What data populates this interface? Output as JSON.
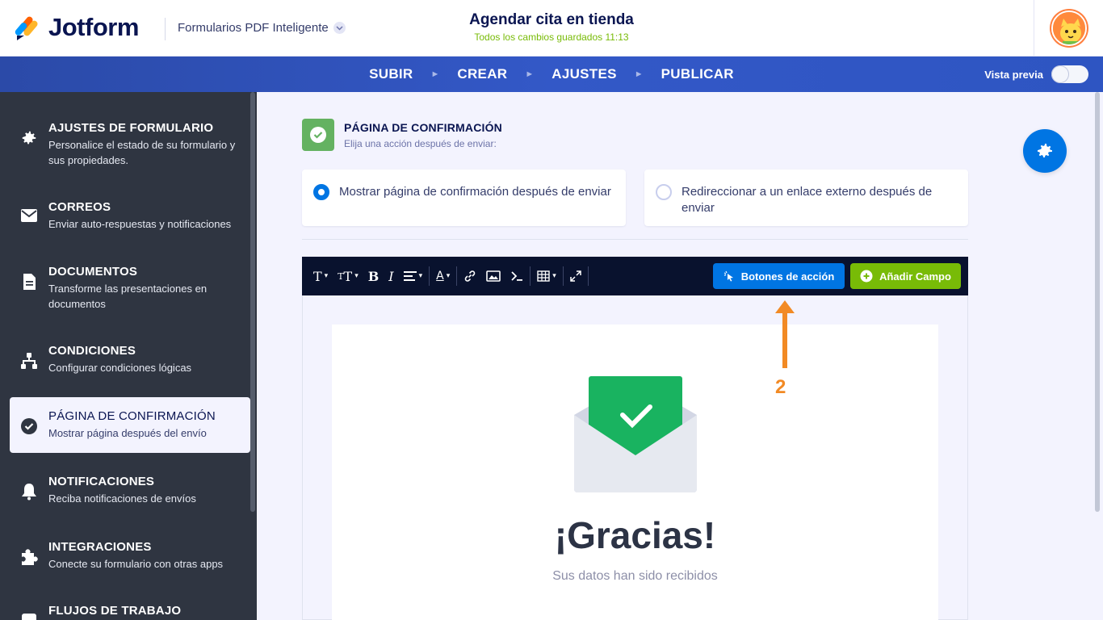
{
  "header": {
    "logo_text": "Jotform",
    "product": "Formularios PDF Inteligente",
    "form_title": "Agendar cita en tienda",
    "saved_status": "Todos los cambios guardados 11:13"
  },
  "nav": {
    "steps": [
      "SUBIR",
      "CREAR",
      "AJUSTES",
      "PUBLICAR"
    ],
    "preview_label": "Vista previa",
    "preview_enabled": false
  },
  "sidebar": {
    "items": [
      {
        "title": "AJUSTES DE FORMULARIO",
        "desc": "Personalice el estado de su formulario y sus propiedades.",
        "icon": "gear-icon"
      },
      {
        "title": "CORREOS",
        "desc": "Enviar auto-respuestas y notificaciones",
        "icon": "envelope-icon"
      },
      {
        "title": "DOCUMENTOS",
        "desc": "Transforme las presentaciones en documentos",
        "icon": "document-icon"
      },
      {
        "title": "CONDICIONES",
        "desc": "Configurar condiciones lógicas",
        "icon": "sitemap-icon"
      },
      {
        "title": "PÁGINA DE CONFIRMACIÓN",
        "desc": "Mostrar página después del envío",
        "icon": "check-circle-icon",
        "active": true
      },
      {
        "title": "NOTIFICACIONES",
        "desc": "Reciba notificaciones de envíos",
        "icon": "bell-icon"
      },
      {
        "title": "INTEGRACIONES",
        "desc": "Conecte su formulario con otras apps",
        "icon": "puzzle-icon"
      },
      {
        "title": "FLUJOS DE TRABAJO",
        "desc": "",
        "icon": "workflow-icon"
      }
    ]
  },
  "section": {
    "title": "PÁGINA DE CONFIRMACIÓN",
    "subtitle": "Elija una acción después de enviar:"
  },
  "options": [
    {
      "label": "Mostrar página de confirmación después de enviar",
      "selected": true
    },
    {
      "label": "Redireccionar a un enlace externo después de enviar",
      "selected": false
    }
  ],
  "toolbar": {
    "action_buttons_label": "Botones de acción",
    "add_field_label": "Añadir Campo"
  },
  "preview_card": {
    "heading": "¡Gracias!",
    "message": "Sus datos han sido recibidos"
  },
  "annotation": {
    "step_number": "2",
    "color": "#f28a24"
  },
  "colors": {
    "primary_blue": "#0075e3",
    "green": "#78bb07",
    "sidebar_bg": "#2f3541",
    "nav_blue": "#3358c7"
  }
}
